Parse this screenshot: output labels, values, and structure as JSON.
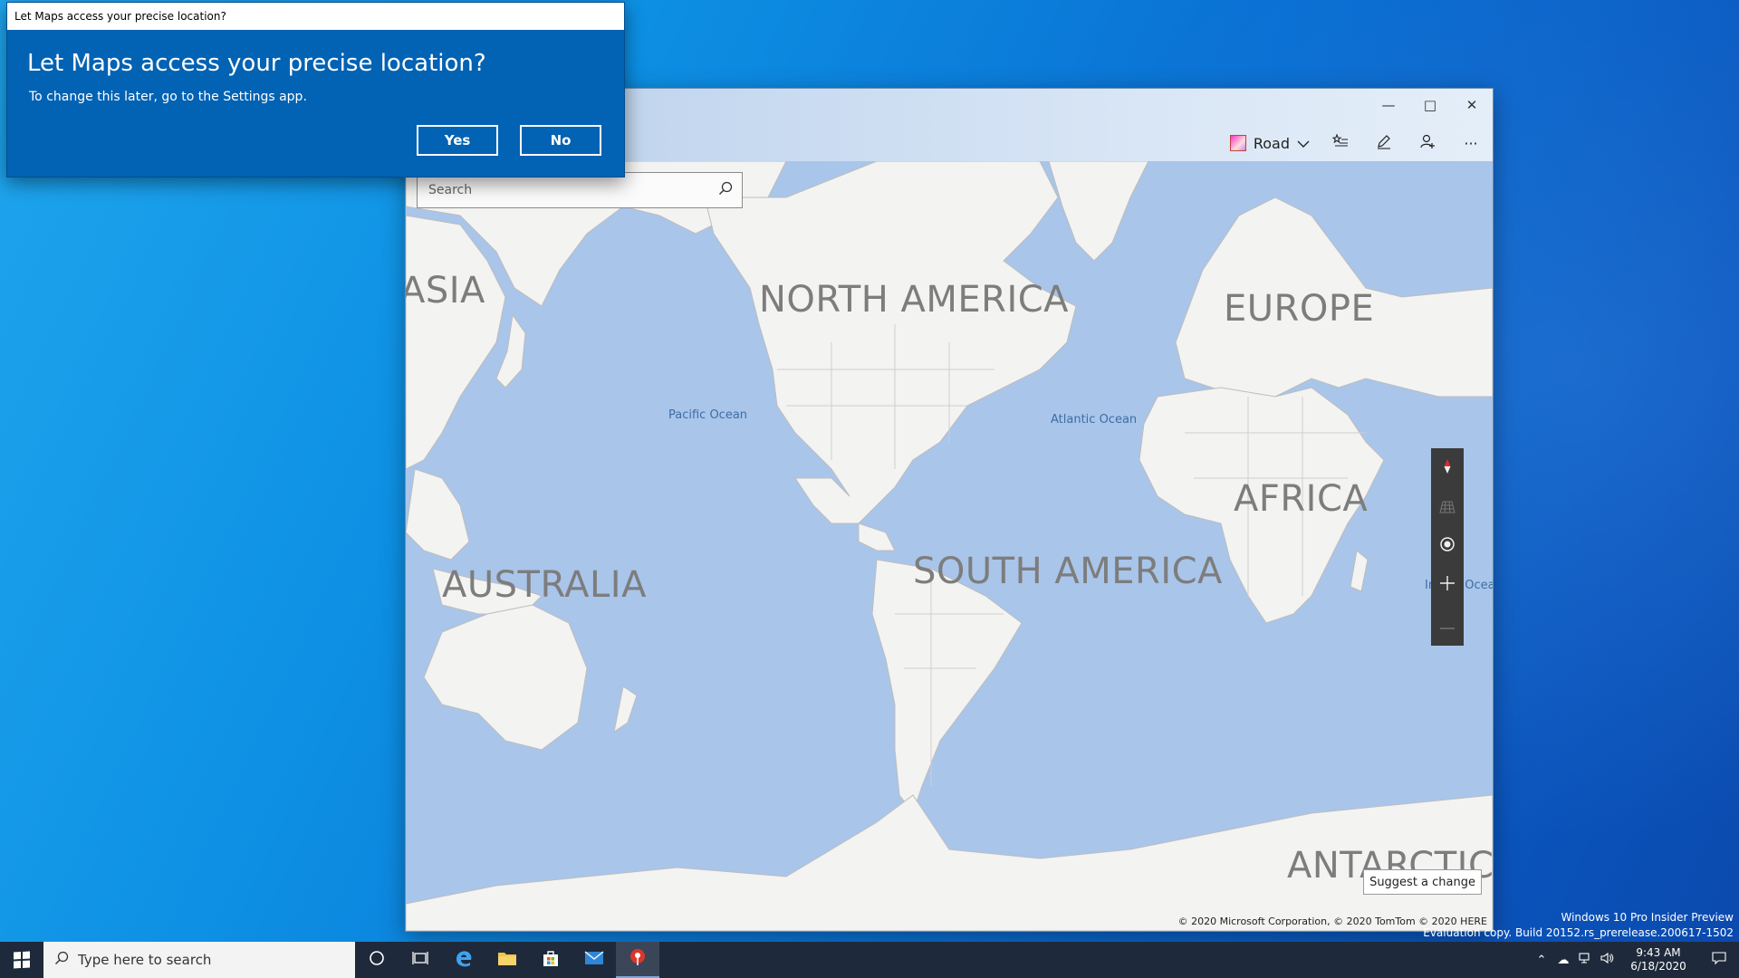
{
  "dialog": {
    "title_bar": "Let Maps access your precise location?",
    "heading": "Let Maps access your precise location?",
    "subtext": "To change this later, go to the Settings app.",
    "yes_label": "Yes",
    "no_label": "No"
  },
  "maps": {
    "toolbar": {
      "map_style_label": "Road",
      "more_label": "···"
    },
    "search": {
      "placeholder": "Search"
    },
    "labels": {
      "asia": "ASIA",
      "north_america": "NORTH AMERICA",
      "europe": "EUROPE",
      "africa": "AFRICA",
      "south_america": "SOUTH AMERICA",
      "australia": "AUSTRALIA",
      "antarctica": "ANTARCTICA",
      "pacific_ocean": "Pacific Ocean",
      "atlantic_ocean": "Atlantic Ocean",
      "indian_ocean": "Indian Ocean"
    },
    "suggest_label": "Suggest a change",
    "copyright": "© 2020 Microsoft Corporation, © 2020 TomTom © 2020 HERE"
  },
  "desktop": {
    "edition_line": "Windows 10 Pro Insider Preview",
    "build_line": "Evaluation copy. Build 20152.rs_prerelease.200617-1502"
  },
  "taskbar": {
    "search_placeholder": "Type here to search",
    "time": "9:43 AM",
    "date": "6/18/2020"
  },
  "colors": {
    "dialog_bg": "#0262b3",
    "taskbar_bg": "#1e2a3b",
    "ocean": "#a9c5ea",
    "land": "#f3f3f1"
  }
}
